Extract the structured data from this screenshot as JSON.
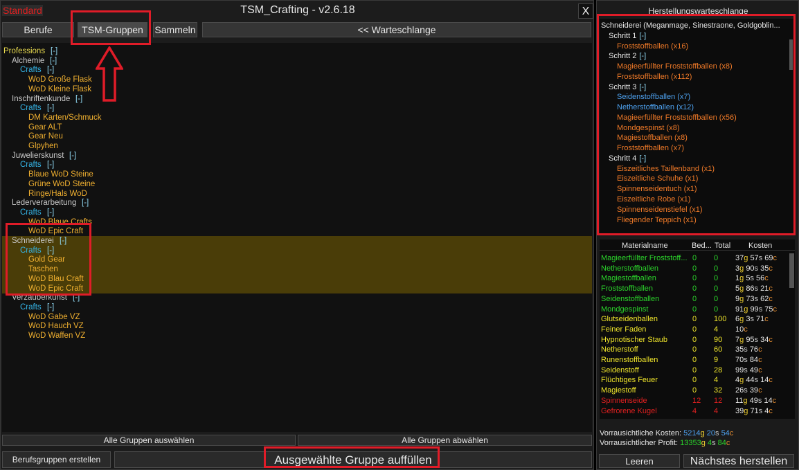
{
  "window": {
    "profile_label": "Standard",
    "title": "TSM_Crafting - v2.6.18",
    "close_label": "X"
  },
  "tabs": [
    {
      "label": "Berufe"
    },
    {
      "label": "TSM-Gruppen"
    },
    {
      "label": "Sammeln"
    }
  ],
  "queue_toggle_label": "<< Warteschlange",
  "tree": [
    {
      "name": "Professions",
      "level": 0,
      "type": "prof",
      "toggle": "[-]"
    },
    {
      "name": "Alchemie",
      "level": 1,
      "type": "cat",
      "toggle": "[-]"
    },
    {
      "name": "Crafts",
      "level": 2,
      "type": "crafts",
      "toggle": "[-]"
    },
    {
      "name": "WoD Große Flask",
      "level": 3,
      "type": "item",
      "toggle": ""
    },
    {
      "name": "WoD Kleine Flask",
      "level": 3,
      "type": "item",
      "toggle": ""
    },
    {
      "name": "Inschriftenkunde",
      "level": 1,
      "type": "cat",
      "toggle": "[-]"
    },
    {
      "name": "Crafts",
      "level": 2,
      "type": "crafts",
      "toggle": "[-]"
    },
    {
      "name": "DM Karten/Schmuck",
      "level": 3,
      "type": "item",
      "toggle": ""
    },
    {
      "name": "Gear ALT",
      "level": 3,
      "type": "item",
      "toggle": ""
    },
    {
      "name": "Gear Neu",
      "level": 3,
      "type": "item",
      "toggle": ""
    },
    {
      "name": "Glpyhen",
      "level": 3,
      "type": "item",
      "toggle": ""
    },
    {
      "name": "Juwelierskunst",
      "level": 1,
      "type": "cat",
      "toggle": "[-]"
    },
    {
      "name": "Crafts",
      "level": 2,
      "type": "crafts",
      "toggle": "[-]"
    },
    {
      "name": "Blaue WoD Steine",
      "level": 3,
      "type": "item",
      "toggle": ""
    },
    {
      "name": "Grüne WoD Steine",
      "level": 3,
      "type": "item",
      "toggle": ""
    },
    {
      "name": "Ringe/Hals WoD",
      "level": 3,
      "type": "item",
      "toggle": ""
    },
    {
      "name": "Lederverarbeitung",
      "level": 1,
      "type": "cat",
      "toggle": "[-]"
    },
    {
      "name": "Crafts",
      "level": 2,
      "type": "crafts",
      "toggle": "[-]"
    },
    {
      "name": "WoD Blaue Crafts",
      "level": 3,
      "type": "item",
      "toggle": ""
    },
    {
      "name": "WoD Epic Craft",
      "level": 3,
      "type": "item",
      "toggle": ""
    },
    {
      "name": "Schneiderei",
      "level": 1,
      "type": "cat",
      "toggle": "[-]",
      "selected": true
    },
    {
      "name": "Crafts",
      "level": 2,
      "type": "crafts",
      "toggle": "[-]",
      "selected": true
    },
    {
      "name": "Gold Gear",
      "level": 3,
      "type": "item",
      "toggle": "",
      "selected": true
    },
    {
      "name": "Taschen",
      "level": 3,
      "type": "item",
      "toggle": "",
      "selected": true
    },
    {
      "name": "WoD Blau Craft",
      "level": 3,
      "type": "item",
      "toggle": "",
      "selected": true
    },
    {
      "name": "WoD Epic Craft",
      "level": 3,
      "type": "item",
      "toggle": "",
      "selected": true
    },
    {
      "name": "Verzauberkunst",
      "level": 1,
      "type": "cat",
      "toggle": "[-]"
    },
    {
      "name": "Crafts",
      "level": 2,
      "type": "crafts",
      "toggle": "[-]"
    },
    {
      "name": "WoD Gabe VZ",
      "level": 3,
      "type": "item",
      "toggle": ""
    },
    {
      "name": "WoD Hauch VZ",
      "level": 3,
      "type": "item",
      "toggle": ""
    },
    {
      "name": "WoD Waffen VZ",
      "level": 3,
      "type": "item",
      "toggle": ""
    }
  ],
  "bottom": {
    "select_all": "Alle Gruppen auswählen",
    "deselect_all": "Alle Gruppen abwählen",
    "create_groups": "Berufsgruppen erstellen",
    "fill_group": "Ausgewählte Gruppe auffüllen"
  },
  "queue": {
    "title": "Herstellungswarteschlange",
    "header": "Schneiderei (Meganmage, Sinestraone, Goldgoblin...",
    "steps": [
      {
        "label": "Schritt 1",
        "toggle": "[-]",
        "items": [
          {
            "name": "Froststoffballen (x16)",
            "color": "orange"
          }
        ]
      },
      {
        "label": "Schritt 2",
        "toggle": "[-]",
        "items": [
          {
            "name": "Magieerfüllter Froststoffballen (x8)",
            "color": "orange"
          },
          {
            "name": "Froststoffballen (x112)",
            "color": "orange"
          }
        ]
      },
      {
        "label": "Schritt 3",
        "toggle": "[-]",
        "items": [
          {
            "name": "Seidenstoffballen (x7)",
            "color": "blue"
          },
          {
            "name": "Netherstoffballen (x12)",
            "color": "blue"
          },
          {
            "name": "Magieerfüllter Froststoffballen (x56)",
            "color": "orange"
          },
          {
            "name": "Mondgespinst (x8)",
            "color": "orange"
          },
          {
            "name": "Magiestoffballen (x8)",
            "color": "orange"
          },
          {
            "name": "Froststoffballen (x7)",
            "color": "orange"
          }
        ]
      },
      {
        "label": "Schritt 4",
        "toggle": "[-]",
        "items": [
          {
            "name": "Eiszeitliches Taillenband (x1)",
            "color": "orange"
          },
          {
            "name": "Eiszeitliche Schuhe (x1)",
            "color": "orange"
          },
          {
            "name": "Spinnenseidentuch (x1)",
            "color": "orange"
          },
          {
            "name": "Eiszeitliche Robe (x1)",
            "color": "orange"
          },
          {
            "name": "Spinnenseidenstiefel (x1)",
            "color": "orange"
          },
          {
            "name": "Fliegender Teppich (x1)",
            "color": "orange"
          }
        ]
      }
    ]
  },
  "materials": {
    "headers": {
      "name": "Materialname",
      "need": "Bed...",
      "total": "Total",
      "cost": "Kosten"
    },
    "rows": [
      {
        "name": "Magieerfüllter Froststoff...",
        "need": "0",
        "total": "0",
        "g": "37",
        "s": "57",
        "c": "69",
        "color": "green"
      },
      {
        "name": "Netherstoffballen",
        "need": "0",
        "total": "0",
        "g": "3",
        "s": "90",
        "c": "35",
        "color": "green"
      },
      {
        "name": "Magiestoffballen",
        "need": "0",
        "total": "0",
        "g": "1",
        "s": "5",
        "c": "56",
        "color": "green"
      },
      {
        "name": "Froststoffballen",
        "need": "0",
        "total": "0",
        "g": "5",
        "s": "86",
        "c": "21",
        "color": "green"
      },
      {
        "name": "Seidenstoffballen",
        "need": "0",
        "total": "0",
        "g": "9",
        "s": "73",
        "c": "62",
        "color": "green"
      },
      {
        "name": "Mondgespinst",
        "need": "0",
        "total": "0",
        "g": "91",
        "s": "99",
        "c": "75",
        "color": "green"
      },
      {
        "name": "Glutseidenballen",
        "need": "0",
        "total": "100",
        "g": "6",
        "s": "3",
        "c": "71",
        "color": "yellow"
      },
      {
        "name": "Feiner Faden",
        "need": "0",
        "total": "4",
        "g": "",
        "s": "",
        "c": "10",
        "color": "yellow"
      },
      {
        "name": "Hypnotischer Staub",
        "need": "0",
        "total": "90",
        "g": "7",
        "s": "95",
        "c": "34",
        "color": "yellow"
      },
      {
        "name": "Netherstoff",
        "need": "0",
        "total": "60",
        "g": "",
        "s": "35",
        "c": "76",
        "color": "yellow"
      },
      {
        "name": "Runenstoffballen",
        "need": "0",
        "total": "9",
        "g": "",
        "s": "70",
        "c": "84",
        "color": "yellow"
      },
      {
        "name": "Seidenstoff",
        "need": "0",
        "total": "28",
        "g": "",
        "s": "99",
        "c": "49",
        "color": "yellow"
      },
      {
        "name": "Flüchtiges Feuer",
        "need": "0",
        "total": "4",
        "g": "4",
        "s": "44",
        "c": "14",
        "color": "yellow"
      },
      {
        "name": "Magiestoff",
        "need": "0",
        "total": "32",
        "g": "",
        "s": "26",
        "c": "39",
        "color": "yellow"
      },
      {
        "name": "Spinnenseide",
        "need": "12",
        "total": "12",
        "g": "11",
        "s": "49",
        "c": "14",
        "color": "red"
      },
      {
        "name": "Gefrorene Kugel",
        "need": "4",
        "total": "4",
        "g": "39",
        "s": "71",
        "c": "4",
        "color": "red"
      }
    ]
  },
  "summary": {
    "cost_label": "Vorrausichtliche Kosten:",
    "cost_g": "5214",
    "cost_s": "20",
    "cost_c": "54",
    "profit_label": "Vorrausichtlicher Profit:",
    "profit_g": "13353",
    "profit_s": "4",
    "profit_c": "84"
  },
  "side_buttons": {
    "clear": "Leeren",
    "craft_next": "Nächstes herstellen"
  },
  "unit_labels": {
    "g": "g",
    "s": "s",
    "c": "c"
  }
}
